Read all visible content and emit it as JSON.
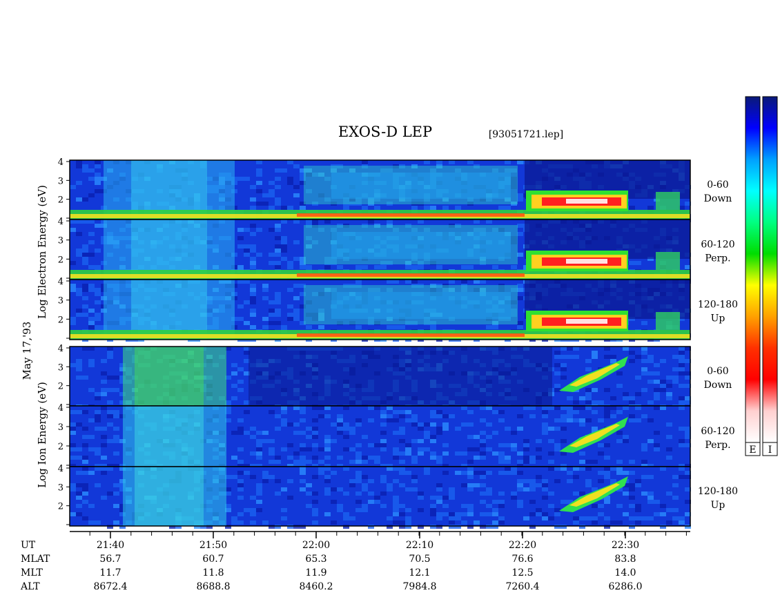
{
  "title": "EXOS-D LEP",
  "file_label": "[93051721.lep]",
  "date_label": "May 17,'93",
  "electron_ylabel": "Log   Electron   Energy   (eV)",
  "ion_ylabel": "Log   Ion   Energy   (eV)",
  "colorbar": {
    "labels": [
      "E",
      "I"
    ],
    "colors": [
      "#0a1a78",
      "#0000ff",
      "#00a0ff",
      "#00ffff",
      "#00ff80",
      "#00dd00",
      "#ffff00",
      "#ffa000",
      "#ff3000",
      "#ff0000",
      "#ffd0d0",
      "#ffffff"
    ]
  },
  "panels": [
    {
      "group": "Electron",
      "pitch": "0-60",
      "dir": "Down",
      "ylim": [
        1,
        4
      ],
      "yticks": [
        "2",
        "3",
        "4"
      ]
    },
    {
      "group": "Electron",
      "pitch": "60-120",
      "dir": "Perp.",
      "ylim": [
        1,
        4
      ],
      "yticks": [
        "2",
        "3",
        "4"
      ]
    },
    {
      "group": "Electron",
      "pitch": "120-180",
      "dir": "Up",
      "ylim": [
        1,
        4
      ],
      "yticks": [
        "2",
        "3",
        "4"
      ]
    },
    {
      "group": "Ion",
      "pitch": "0-60",
      "dir": "Down",
      "ylim": [
        1,
        4
      ],
      "yticks": [
        "2",
        "3",
        "4"
      ]
    },
    {
      "group": "Ion",
      "pitch": "60-120",
      "dir": "Perp.",
      "ylim": [
        1,
        4
      ],
      "yticks": [
        "2",
        "3",
        "4"
      ]
    },
    {
      "group": "Ion",
      "pitch": "120-180",
      "dir": "Up",
      "ylim": [
        1,
        4
      ],
      "yticks": [
        "2",
        "3",
        "4"
      ]
    }
  ],
  "chart_data": {
    "type": "heatmap",
    "title": "EXOS-D LEP",
    "x_axis": {
      "label": "UT",
      "range_minutes": [
        21.6,
        21.95
      ],
      "ticks": [
        "21:40",
        "21:50",
        "22:00",
        "22:10",
        "22:20",
        "22:30"
      ]
    },
    "ephemeris": {
      "rows": [
        {
          "name": "UT",
          "values": [
            "21:40",
            "21:50",
            "22:00",
            "22:10",
            "22:20",
            "22:30"
          ]
        },
        {
          "name": "MLAT",
          "values": [
            "56.7",
            "60.7",
            "65.3",
            "70.5",
            "76.6",
            "83.8"
          ]
        },
        {
          "name": "MLT",
          "values": [
            "11.7",
            "11.8",
            "11.9",
            "12.1",
            "12.5",
            "14.0"
          ]
        },
        {
          "name": "ALT",
          "values": [
            "8672.4",
            "8688.8",
            "8460.2",
            "7984.8",
            "7260.4",
            "6286.0"
          ]
        }
      ]
    },
    "y_axis": {
      "label": "Log Energy (eV)",
      "range": [
        1,
        4
      ],
      "ticks": [
        "2",
        "3",
        "4"
      ]
    },
    "series": [
      {
        "name": "Electron 0-60 Down"
      },
      {
        "name": "Electron 60-120 Perp."
      },
      {
        "name": "Electron 120-180 Up"
      },
      {
        "name": "Ion 0-60 Down"
      },
      {
        "name": "Ion 60-120 Perp."
      },
      {
        "name": "Ion 120-180 Up"
      }
    ]
  }
}
